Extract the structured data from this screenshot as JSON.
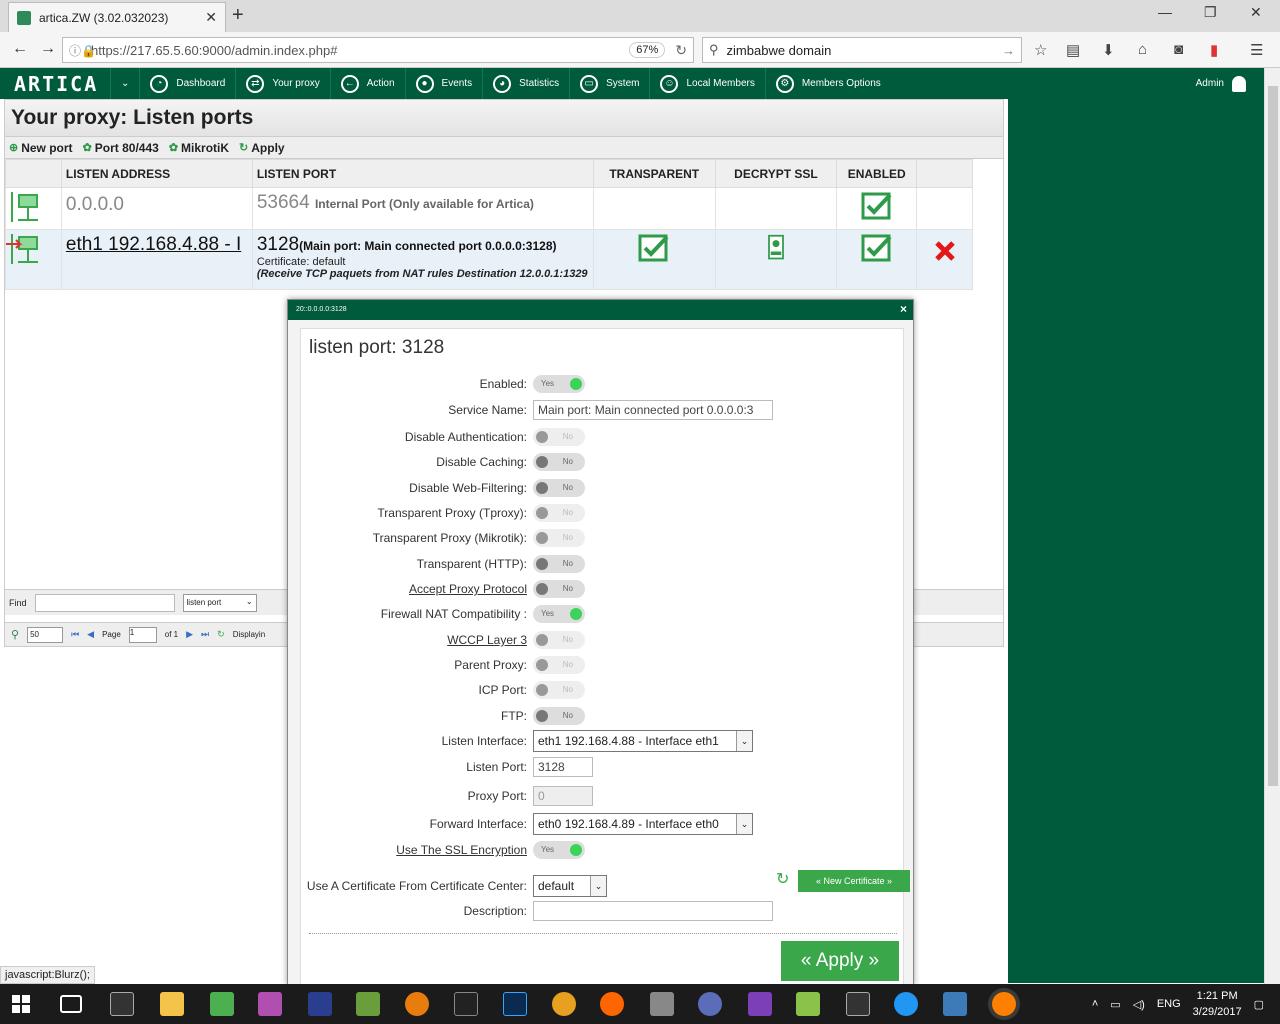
{
  "browser": {
    "tab_title": "artica.ZW (3.02.032023)",
    "url": "https://217.65.5.60:9000/admin.index.php#",
    "zoom": "67%",
    "search": "zimbabwe domain"
  },
  "appbar": {
    "logo": "ARTICA",
    "menu": [
      "Dashboard",
      "Your proxy",
      "Action",
      "Events",
      "Statistics",
      "System",
      "Local Members",
      "Members Options"
    ],
    "user": "Admin"
  },
  "page": {
    "title": "Your proxy: Listen ports",
    "toolbar": {
      "new_port": "New port",
      "port_80": "Port 80/443",
      "mikrotik": "MikrotiK",
      "apply": "Apply"
    },
    "columns": [
      "LISTEN ADDRESS",
      "LISTEN PORT",
      "TRANSPARENT",
      "DECRYPT SSL",
      "ENABLED"
    ],
    "rows": [
      {
        "address": "0.0.0.0",
        "port": "53664",
        "port_note": "Internal Port (Only available for Artica)"
      },
      {
        "address": "eth1 192.168.4.88 - I",
        "port": "3128",
        "port_note": "(Main port: Main connected port 0.0.0.0:3128)",
        "certificate": "Certificate: default",
        "nat": "(Receive TCP paquets from NAT rules Destination 12.0.0.1:1329"
      }
    ],
    "find_label": "Find",
    "find_select": "listen port",
    "page_size": "50",
    "page_label": "Page",
    "page_value": "1",
    "of_label": "of 1",
    "displaying": "Displayin"
  },
  "modal": {
    "header": "20::0.0.0.0:3128",
    "title": "listen port: 3128",
    "fields": {
      "enabled": {
        "label": "Enabled:",
        "value": "Yes"
      },
      "service_name": {
        "label": "Service Name:",
        "value": "Main port: Main connected port 0.0.0.0:3"
      },
      "disable_auth": {
        "label": "Disable Authentication:",
        "value": "No"
      },
      "disable_caching": {
        "label": "Disable Caching:",
        "value": "No"
      },
      "disable_filtering": {
        "label": "Disable Web-Filtering:",
        "value": "No"
      },
      "tproxy": {
        "label": "Transparent Proxy (Tproxy):",
        "value": "No"
      },
      "mikrotik": {
        "label": "Transparent Proxy (Mikrotik):",
        "value": "No"
      },
      "transparent_http": {
        "label": "Transparent (HTTP):",
        "value": "No"
      },
      "accept_proxy": {
        "label": "Accept Proxy Protocol",
        "value": "No"
      },
      "firewall_nat": {
        "label": "Firewall NAT Compatibility :",
        "value": "Yes"
      },
      "wccp": {
        "label": "WCCP Layer 3",
        "value": "No"
      },
      "parent_proxy": {
        "label": "Parent Proxy:",
        "value": "No"
      },
      "icp_port": {
        "label": "ICP Port:",
        "value": "No"
      },
      "ftp": {
        "label": "FTP:",
        "value": "No"
      },
      "listen_interface": {
        "label": "Listen Interface:",
        "value": "eth1 192.168.4.88 - Interface eth1"
      },
      "listen_port": {
        "label": "Listen Port:",
        "value": "3128"
      },
      "proxy_port": {
        "label": "Proxy Port:",
        "value": "0"
      },
      "forward_interface": {
        "label": "Forward Interface:",
        "value": "eth0 192.168.4.89 - Interface eth0"
      },
      "ssl": {
        "label": "Use The SSL Encryption",
        "value": "Yes"
      },
      "cert_center": {
        "label": "Use A Certificate From Certificate Center:",
        "value": "default"
      },
      "description": {
        "label": "Description:",
        "value": ""
      }
    },
    "new_certificate": "« New Certificate »",
    "apply": "« Apply »"
  },
  "status_link": "javascript:Blurz();",
  "taskbar": {
    "language": "ENG",
    "time": "1:21 PM",
    "date": "3/29/2017"
  },
  "colors": {
    "artica_green": "#005a3c",
    "button_green": "#3aa84a",
    "toggle_on": "#3cd35a"
  }
}
